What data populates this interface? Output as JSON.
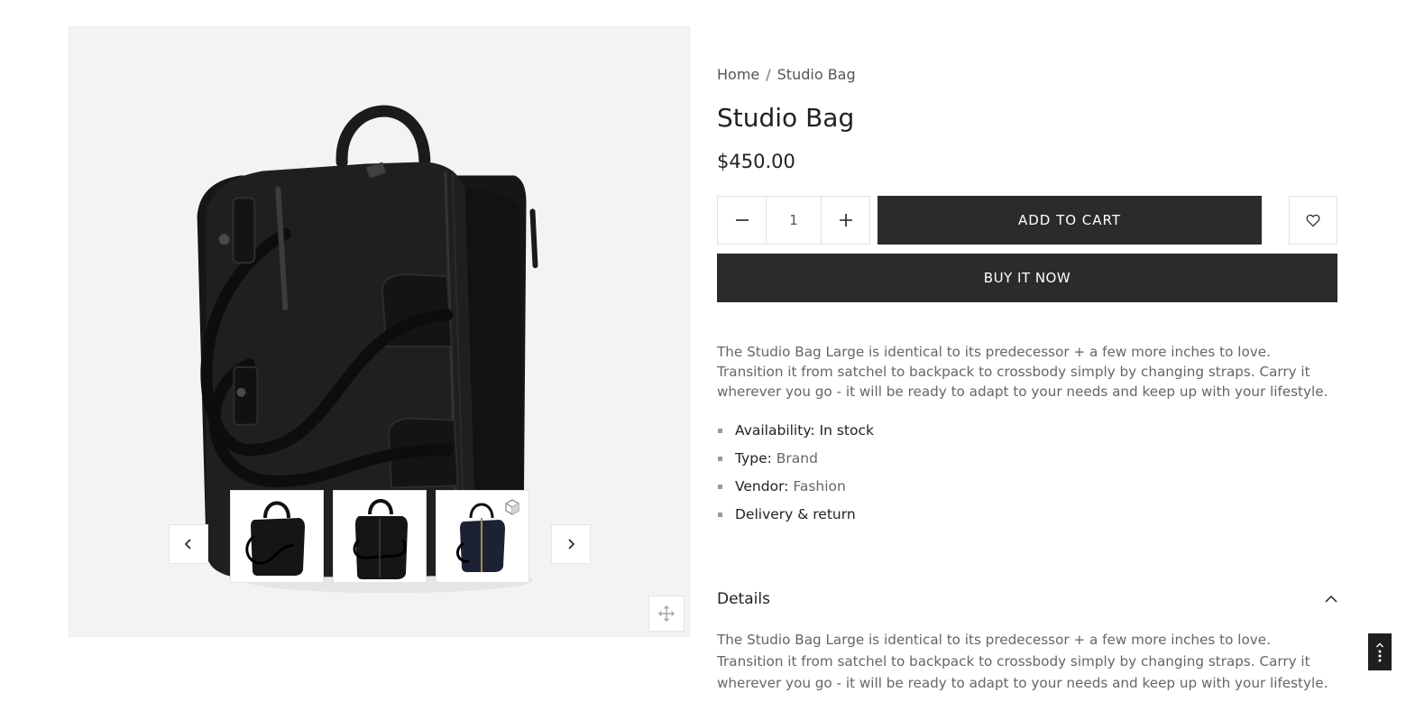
{
  "breadcrumb": {
    "home": "Home",
    "separator": "/",
    "current": "Studio Bag"
  },
  "product": {
    "title": "Studio Bag",
    "price": "$450.00",
    "description": "The Studio Bag Large is identical to its predecessor + a few more inches to love. Transition it from satchel to backpack to crossbody simply by changing straps. Carry it wherever you go - it will be ready to adapt to your needs and keep up with your lifestyle."
  },
  "quantity": {
    "value": "1"
  },
  "actions": {
    "add_to_cart": "ADD TO CART",
    "buy_now": "BUY IT NOW"
  },
  "meta": {
    "availability_label": "Availability:",
    "availability_value": "In stock",
    "type_label": "Type:",
    "type_value": "Brand",
    "vendor_label": "Vendor:",
    "vendor_value": "Fashion",
    "delivery": "Delivery & return"
  },
  "details": {
    "title": "Details",
    "expanded": true,
    "body": "The Studio Bag Large is identical to its predecessor + a few more inches to love. Transition it from satchel to backpack to crossbody simply by changing straps. Carry it wherever you go - it will be ready to adapt to your needs and keep up with your lifestyle."
  },
  "icons": {
    "prev": "chevron-left-icon",
    "next": "chevron-right-icon",
    "zoom": "move-arrows-icon",
    "minus": "minus-icon",
    "plus": "plus-icon",
    "wishlist": "heart-icon",
    "details_toggle": "chevron-up-icon",
    "scroll_top": "arrow-up-icon",
    "model": "cube-icon"
  },
  "colors": {
    "button_bg": "#2b2b2b",
    "gallery_bg": "#f3f3f3",
    "text_muted": "#666666"
  }
}
